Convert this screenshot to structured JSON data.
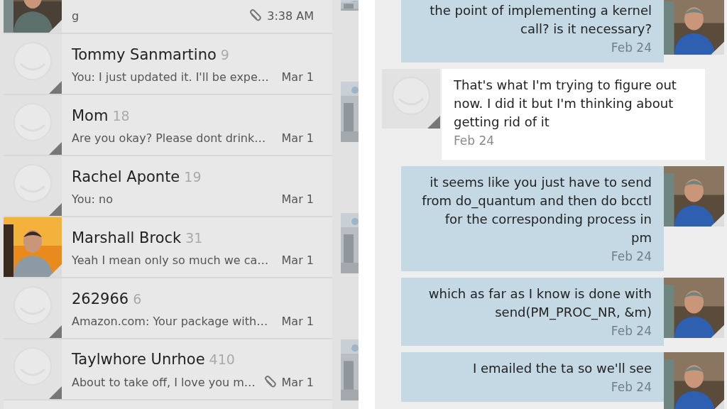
{
  "conversations": [
    {
      "snippet": "g",
      "time": "3:38 AM",
      "attachment": true
    },
    {
      "kind": "default",
      "name": "Tommy Sanmartino",
      "count": "9",
      "snippet": "You: I just updated it. I'll be expe…",
      "time": "Mar 1",
      "attachment": false
    },
    {
      "kind": "default",
      "name": "Mom",
      "count": "18",
      "snippet": "Are you okay? Please dont drink…",
      "time": "Mar 1",
      "attachment": false
    },
    {
      "kind": "default",
      "name": "Rachel Aponte",
      "count": "19",
      "snippet": "You: no",
      "time": "Mar 1",
      "attachment": false
    },
    {
      "name": "Marshall Brock",
      "count": "31",
      "snippet": "Yeah I mean only so much we ca…",
      "time": "Mar 1",
      "attachment": false
    },
    {
      "kind": "default",
      "name": "262966",
      "count": "6",
      "snippet": "Amazon.com: Your package with…",
      "time": "Mar 1",
      "attachment": false
    },
    {
      "kind": "default",
      "name": "Taylwhore Unrhoe",
      "count": "410",
      "snippet": "About to take off, I love you m…",
      "time": "Mar 1",
      "attachment": true
    }
  ],
  "messages": [
    {
      "kind": "sent",
      "lines": [
        "the point of implementing a kernel",
        "call? is it necessary?"
      ],
      "date": "Feb 24"
    },
    {
      "kind": "received",
      "lines": [
        "That's what I'm trying to figure out",
        "now. I did it but I'm thinking about",
        "getting rid of it"
      ],
      "date": "Feb 24"
    },
    {
      "kind": "sent",
      "lines": [
        "it seems like you just have to send",
        "from do_quantum and then do bcctl",
        "for the corresponding process in",
        "pm"
      ],
      "date": "Feb 24"
    },
    {
      "kind": "sent",
      "lines": [
        "which as far as I know is done with",
        "send(PM_PROC_NR, &m)"
      ],
      "date": "Feb 24"
    },
    {
      "kind": "sent",
      "lines": [
        "I emailed the ta so we'll see"
      ],
      "date": "Feb 24"
    }
  ]
}
